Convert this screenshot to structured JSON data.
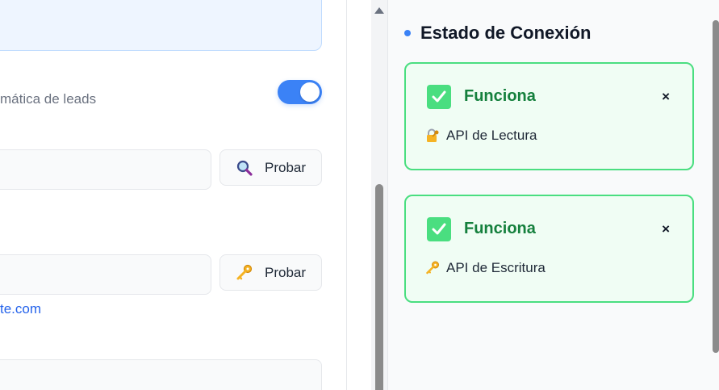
{
  "left": {
    "toggle_label": "mática de leads",
    "toggle_on": true,
    "test_button_1": {
      "label": "Probar",
      "icon": "magnifier-icon"
    },
    "test_button_2": {
      "label": "Probar",
      "icon": "key-icon"
    },
    "link_text": "te.com"
  },
  "right": {
    "section_title": "Estado de Conexión",
    "cards": [
      {
        "status": "Funciona",
        "api_label": "API de Lectura",
        "icon": "lock-key-icon",
        "close": "×"
      },
      {
        "status": "Funciona",
        "api_label": "API de Escritura",
        "icon": "key-icon",
        "close": "×"
      }
    ]
  },
  "colors": {
    "accent": "#3b82f6",
    "success_bg": "#f0fdf4",
    "success_border": "#4ade80",
    "success_text": "#15803d",
    "link": "#2563eb"
  }
}
